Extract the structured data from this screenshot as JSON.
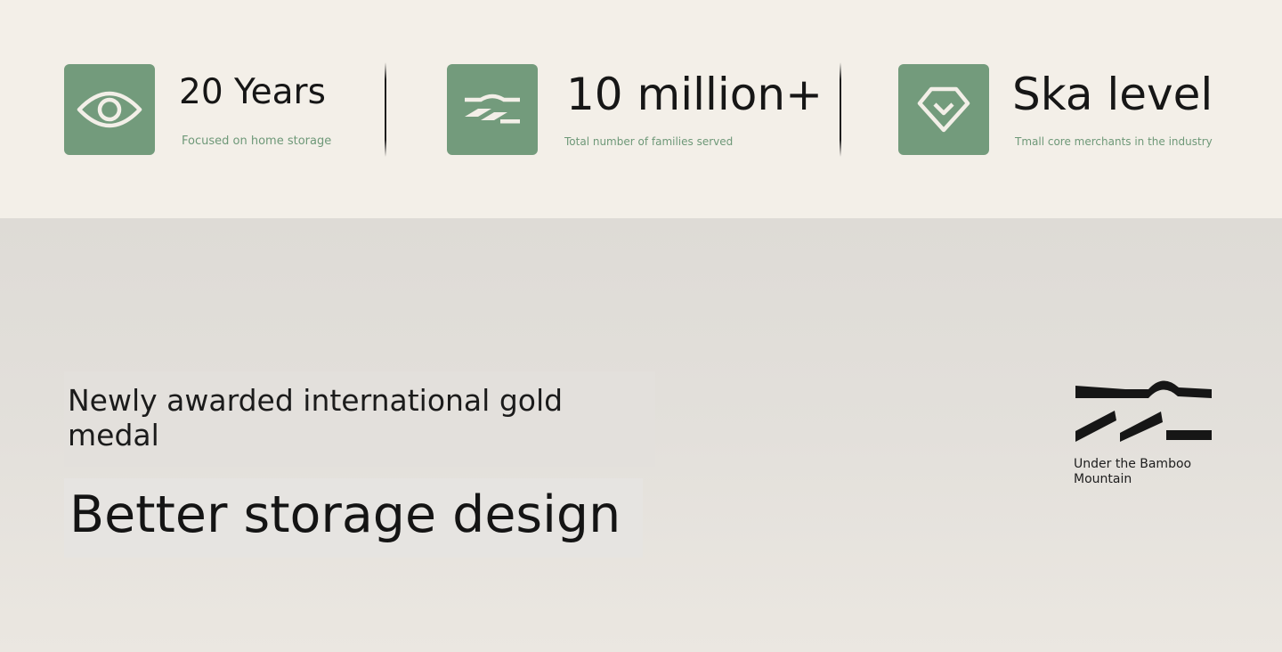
{
  "stats": [
    {
      "icon": "eye-icon",
      "value": "20 Years",
      "caption": "Focused on home storage"
    },
    {
      "icon": "wave-lines-icon",
      "value": "10 million+",
      "caption": "Total number of families served"
    },
    {
      "icon": "diamond-icon",
      "value": "Ska level",
      "caption": "Tmall core merchants in the industry"
    }
  ],
  "hero": {
    "award": "Newly awarded international gold medal",
    "headline": "Better storage design"
  },
  "brand": {
    "name": "Under the Bamboo Mountain",
    "logo_icon": "mountain-wave-logo"
  },
  "colors": {
    "accent": "#739b7c",
    "caption": "#6e9878",
    "stats_background": "#f3efe8",
    "hero_background": "#e3e0db"
  }
}
